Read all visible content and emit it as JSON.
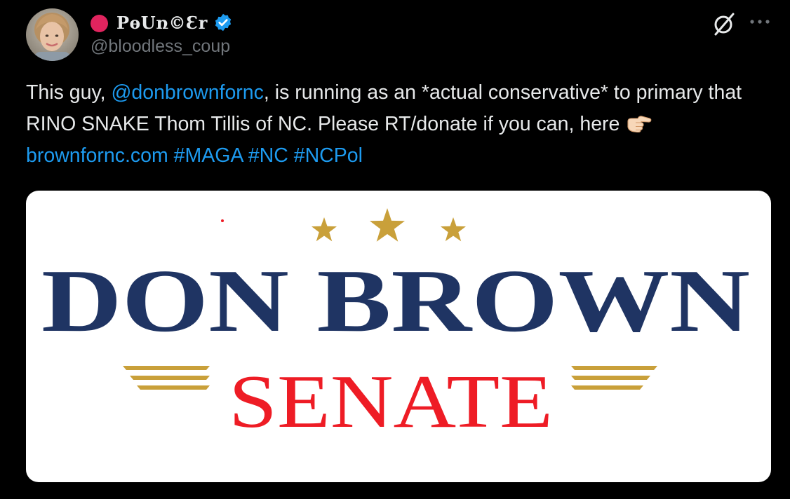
{
  "author": {
    "display_name": "PѳUռ©Ɛr",
    "handle": "@bloodless_coup",
    "verified": true,
    "status_color": "#e0245e"
  },
  "icons": {
    "grok": "grok-slash-circle-icon",
    "more": "more-horizontal-icon",
    "verified": "verified-badge-icon",
    "emoji": "backhand-index-pointing-right-emoji"
  },
  "tweet": {
    "text_1": "This guy, ",
    "mention": "@donbrownfornc",
    "text_2": ", is running as an *actual conservative* to primary that RINO SNAKE Thom Tillis of NC. Please RT/donate if you can, here ",
    "url": "brownfornc.com",
    "hashtags": [
      "#MAGA",
      "#NC",
      "#NCPol"
    ]
  },
  "media": {
    "line1": "DON BROWN",
    "line2": "SENATE",
    "colors": {
      "navy": "#1f3463",
      "red": "#ee1c25",
      "gold": "#c9a03a"
    }
  },
  "colors": {
    "background": "#000000",
    "text": "#e7e9ea",
    "secondary": "#71767b",
    "link": "#1d9bf0"
  }
}
